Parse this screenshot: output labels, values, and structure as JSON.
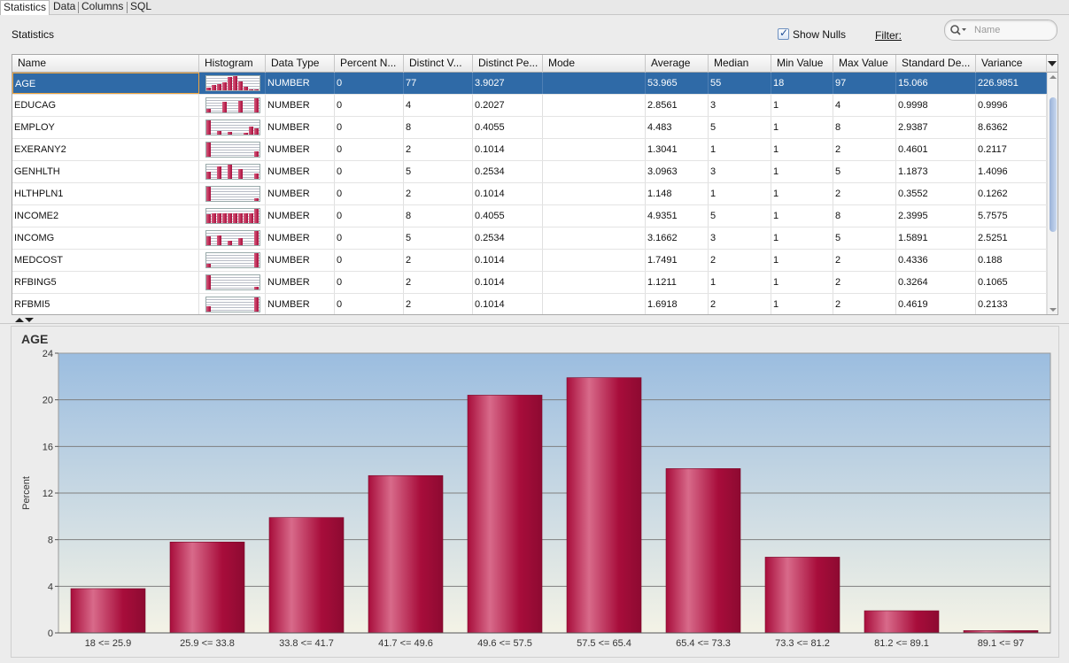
{
  "tabs": [
    {
      "label": "Statistics",
      "active": true
    },
    {
      "label": "Data",
      "active": false
    },
    {
      "label": "Columns",
      "active": false
    },
    {
      "label": "SQL",
      "active": false
    }
  ],
  "toolbar": {
    "section_title": "Statistics",
    "show_nulls_label": "Show Nulls",
    "show_nulls_checked": true,
    "filter_label": "Filter:",
    "filter_placeholder": "Name"
  },
  "table": {
    "columns": [
      "Name",
      "Histogram",
      "Data Type",
      "Percent N...",
      "Distinct V...",
      "Distinct Pe...",
      "Mode",
      "Average",
      "Median",
      "Min Value",
      "Max Value",
      "Standard De...",
      "Variance"
    ],
    "rows": [
      {
        "name": "AGE",
        "type": "NUMBER",
        "pct_null": "0",
        "distinct": "77",
        "distinct_pct": "3.9027",
        "mode": "",
        "avg": "53.965",
        "median": "55",
        "min": "18",
        "max": "97",
        "std": "15.066",
        "variance": "226.9851",
        "selected": true,
        "spark": [
          4,
          8,
          10,
          13,
          20,
          22,
          14,
          6,
          2,
          1
        ]
      },
      {
        "name": "EDUCAG",
        "type": "NUMBER",
        "pct_null": "0",
        "distinct": "4",
        "distinct_pct": "0.2027",
        "mode": "",
        "avg": "2.8561",
        "median": "3",
        "min": "1",
        "max": "4",
        "std": "0.9998",
        "variance": "0.9996",
        "selected": false,
        "spark": [
          5,
          0,
          0,
          13,
          0,
          0,
          15,
          0,
          0,
          18
        ]
      },
      {
        "name": "EMPLOY",
        "type": "NUMBER",
        "pct_null": "0",
        "distinct": "8",
        "distinct_pct": "0.4055",
        "mode": "",
        "avg": "4.483",
        "median": "5",
        "min": "1",
        "max": "8",
        "std": "2.9387",
        "variance": "8.6362",
        "selected": false,
        "spark": [
          18,
          0,
          4,
          0,
          3,
          0,
          0,
          2,
          10,
          8
        ]
      },
      {
        "name": "EXERANY2",
        "type": "NUMBER",
        "pct_null": "0",
        "distinct": "2",
        "distinct_pct": "0.1014",
        "mode": "",
        "avg": "1.3041",
        "median": "1",
        "min": "1",
        "max": "2",
        "std": "0.4601",
        "variance": "0.2117",
        "selected": false,
        "spark": [
          18,
          0,
          0,
          0,
          0,
          0,
          0,
          0,
          0,
          7
        ]
      },
      {
        "name": "GENHLTH",
        "type": "NUMBER",
        "pct_null": "0",
        "distinct": "5",
        "distinct_pct": "0.2534",
        "mode": "",
        "avg": "3.0963",
        "median": "3",
        "min": "1",
        "max": "5",
        "std": "1.1873",
        "variance": "1.4096",
        "selected": false,
        "spark": [
          8,
          0,
          14,
          0,
          16,
          0,
          11,
          0,
          0,
          6
        ]
      },
      {
        "name": "HLTHPLN1",
        "type": "NUMBER",
        "pct_null": "0",
        "distinct": "2",
        "distinct_pct": "0.1014",
        "mode": "",
        "avg": "1.148",
        "median": "1",
        "min": "1",
        "max": "2",
        "std": "0.3552",
        "variance": "0.1262",
        "selected": false,
        "spark": [
          18,
          0,
          0,
          0,
          0,
          0,
          0,
          0,
          0,
          3
        ]
      },
      {
        "name": "INCOME2",
        "type": "NUMBER",
        "pct_null": "0",
        "distinct": "8",
        "distinct_pct": "0.4055",
        "mode": "",
        "avg": "4.9351",
        "median": "5",
        "min": "1",
        "max": "8",
        "std": "2.3995",
        "variance": "5.7575",
        "selected": false,
        "spark": [
          6,
          7,
          7,
          7,
          7,
          7,
          7,
          7,
          7,
          10
        ]
      },
      {
        "name": "INCOMG",
        "type": "NUMBER",
        "pct_null": "0",
        "distinct": "5",
        "distinct_pct": "0.2534",
        "mode": "",
        "avg": "3.1662",
        "median": "3",
        "min": "1",
        "max": "5",
        "std": "1.5891",
        "variance": "2.5251",
        "selected": false,
        "spark": [
          10,
          0,
          11,
          0,
          5,
          0,
          8,
          0,
          0,
          16
        ]
      },
      {
        "name": "MEDCOST",
        "type": "NUMBER",
        "pct_null": "0",
        "distinct": "2",
        "distinct_pct": "0.1014",
        "mode": "",
        "avg": "1.7491",
        "median": "2",
        "min": "1",
        "max": "2",
        "std": "0.4336",
        "variance": "0.188",
        "selected": false,
        "spark": [
          4,
          0,
          0,
          0,
          0,
          0,
          0,
          0,
          0,
          18
        ]
      },
      {
        "name": "RFBING5",
        "type": "NUMBER",
        "pct_null": "0",
        "distinct": "2",
        "distinct_pct": "0.1014",
        "mode": "",
        "avg": "1.1211",
        "median": "1",
        "min": "1",
        "max": "2",
        "std": "0.3264",
        "variance": "0.1065",
        "selected": false,
        "spark": [
          18,
          0,
          0,
          0,
          0,
          0,
          0,
          0,
          0,
          3
        ]
      },
      {
        "name": "RFBMI5",
        "type": "NUMBER",
        "pct_null": "0",
        "distinct": "2",
        "distinct_pct": "0.1014",
        "mode": "",
        "avg": "1.6918",
        "median": "2",
        "min": "1",
        "max": "2",
        "std": "0.4619",
        "variance": "0.2133",
        "selected": false,
        "spark": [
          6,
          0,
          0,
          0,
          0,
          0,
          0,
          0,
          0,
          16
        ]
      }
    ]
  },
  "chart_panel": {
    "title": "AGE"
  },
  "chart_data": {
    "type": "bar",
    "title": "",
    "xlabel": "",
    "ylabel": "Percent",
    "ylim": [
      0,
      24
    ],
    "yticks": [
      0,
      4,
      8,
      12,
      16,
      20,
      24
    ],
    "categories": [
      "18 <= 25.9",
      "25.9 <= 33.8",
      "33.8 <= 41.7",
      "41.7 <= 49.6",
      "49.6 <= 57.5",
      "57.5 <= 65.4",
      "65.4 <= 73.3",
      "73.3 <= 81.2",
      "81.2 <= 89.1",
      "89.1 <= 97"
    ],
    "values": [
      3.8,
      7.8,
      9.9,
      13.5,
      20.4,
      21.9,
      14.1,
      6.5,
      1.9,
      0.2
    ],
    "grid": true
  },
  "colors": {
    "selection": "#2f6aa7",
    "bar_dark": "#a80d3b",
    "bar_light": "#d86a8a",
    "plot_top": "#9bbde0",
    "plot_bottom": "#f4f3e6"
  }
}
